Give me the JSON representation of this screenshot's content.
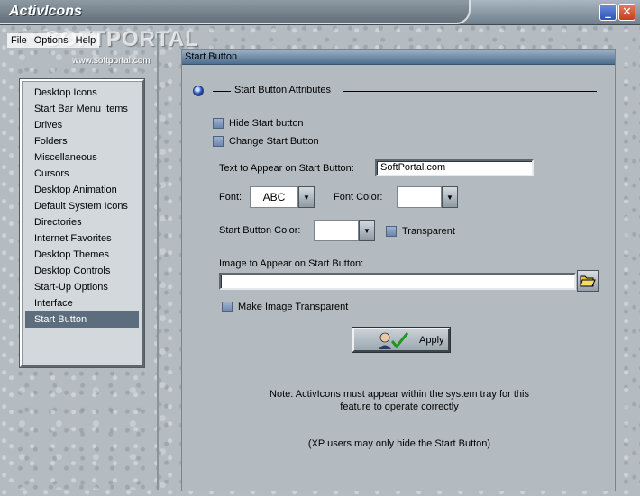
{
  "window": {
    "title": "ActivIcons",
    "minimize_glyph": "_",
    "close_glyph": "✕"
  },
  "menu": {
    "items": [
      "File",
      "Options",
      "Help"
    ]
  },
  "watermark": {
    "brand": "SOFTPORTAL",
    "url": "www.softportal.com"
  },
  "nav": {
    "items": [
      "Desktop Icons",
      "Start Bar Menu Items",
      "Drives",
      "Folders",
      "Miscellaneous",
      "Cursors",
      "Desktop Animation",
      "Default System Icons",
      "Directories",
      "Internet Favorites",
      "Desktop Themes",
      "Desktop Controls",
      "Start-Up Options",
      "Interface",
      "Start Button"
    ],
    "selected": "Start Button"
  },
  "panel": {
    "header": "Start Button",
    "section_title": "Start Button Attributes",
    "hide_start_label": "Hide Start button",
    "change_start_label": "Change Start Button",
    "text_label": "Text to Appear on Start Button:",
    "text_value": "SoftPortal.com",
    "font_label": "Font:",
    "font_value": "ABC",
    "font_color_label": "Font Color:",
    "button_color_label": "Start Button Color:",
    "transparent_label": "Transparent",
    "image_label": "Image to Appear on Start Button:",
    "image_value": "",
    "make_transparent_label": "Make Image Transparent",
    "apply_label": "Apply",
    "note_line1": "Note: ActivIcons must appear within the system tray for this",
    "note_line2": "feature to operate correctly",
    "note_xp": "(XP users may only hide the Start Button)"
  },
  "colors": {
    "selected_nav_bg": "#5c6e7e",
    "header_accent": "#4c6d8f",
    "close_red": "#c2401c",
    "minimize_blue": "#2d55b8"
  },
  "icons": {
    "dropdown": "chevron-down-icon",
    "folder": "open-folder-icon",
    "apply": "checkmark-icon",
    "bullet": "radio-bullet-icon"
  }
}
